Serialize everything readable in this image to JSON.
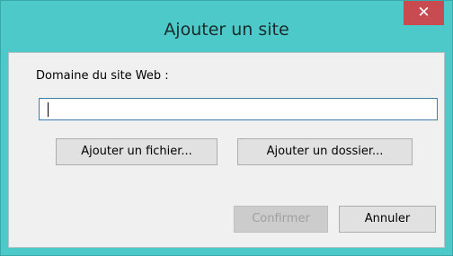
{
  "dialog": {
    "title": "Ajouter un site",
    "close_glyph": "✕",
    "domain_label": "Domaine du site Web :",
    "domain_value": "",
    "domain_placeholder": "",
    "add_file_label": "Ajouter un fichier...",
    "add_folder_label": "Ajouter un dossier...",
    "confirm_label": "Confirmer",
    "cancel_label": "Annuler"
  },
  "colors": {
    "title_bar": "#4ec9c9",
    "close_button": "#c74b50",
    "client_area": "#f0f0f0",
    "input_border": "#3c7fb1"
  },
  "icons": {
    "close": "close-icon"
  }
}
